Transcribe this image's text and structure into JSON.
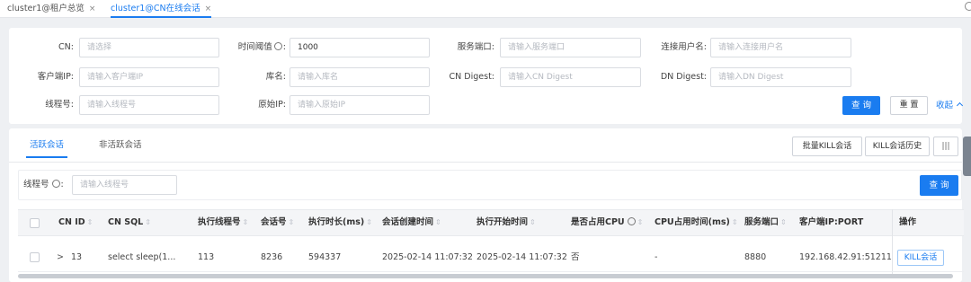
{
  "tabs": [
    {
      "label": "cluster1@租户总览",
      "close": "×"
    },
    {
      "label": "cluster1@CN在线会话",
      "close": "×"
    }
  ],
  "filters": {
    "cn": {
      "label": "CN:",
      "placeholder": "请选择"
    },
    "time_threshold": {
      "label": "时间阈值",
      "suffix": ":",
      "value": "1000"
    },
    "service_port": {
      "label": "服务端口:",
      "placeholder": "请输入服务端口"
    },
    "connect_user": {
      "label": "连接用户名:",
      "placeholder": "请输入连接用户名"
    },
    "client_ip": {
      "label": "客户端IP:",
      "placeholder": "请输入客户端IP"
    },
    "db_name": {
      "label": "库名:",
      "placeholder": "请输入库名"
    },
    "cn_digest": {
      "label": "CN Digest:",
      "placeholder": "请输入CN Digest"
    },
    "dn_digest": {
      "label": "DN Digest:",
      "placeholder": "请输入DN Digest"
    },
    "thread_no": {
      "label": "线程号:",
      "placeholder": "请输入线程号"
    },
    "origin_ip": {
      "label": "原始IP:",
      "placeholder": "请输入原始IP"
    },
    "query_btn": "查 询",
    "reset_btn": "重 置",
    "collapse": "收起"
  },
  "session_tabs": [
    "活跃会话",
    "非活跃会话"
  ],
  "toolbar": {
    "batch_kill": "批量KILL会话",
    "kill_history": "KILL会话历史",
    "columns_icon": "|||"
  },
  "inner_search": {
    "label": "线程号",
    "suffix": ":",
    "placeholder": "请输入线程号",
    "query_btn": "查 询"
  },
  "table": {
    "headers": {
      "cn_id": "CN ID",
      "cn_sql": "CN SQL",
      "exec_thread": "执行线程号",
      "session_no": "会话号",
      "exec_duration": "执行时长(ms)",
      "session_created": "会话创建时间",
      "exec_start": "执行开始时间",
      "cpu_used": "是否占用CPU",
      "cpu_time": "CPU占用时间(ms)",
      "service_port": "服务端口",
      "client_ip_port": "客户端IP:PORT",
      "actions": "操作"
    },
    "rows": [
      {
        "expand": ">",
        "cn_id": "13",
        "cn_sql": "select sleep(1...",
        "exec_thread": "113",
        "session_no": "8236",
        "exec_duration": "594337",
        "session_created": "2025-02-14 11:07:32",
        "exec_start": "2025-02-14 11:07:32",
        "cpu_used": "否",
        "cpu_time": "-",
        "service_port": "8880",
        "client_ip_port": "192.168.42.91:51211",
        "action": "KILL会话"
      }
    ]
  },
  "colors": {
    "accent": "#1a7cf0",
    "background": "#eef0f3"
  }
}
